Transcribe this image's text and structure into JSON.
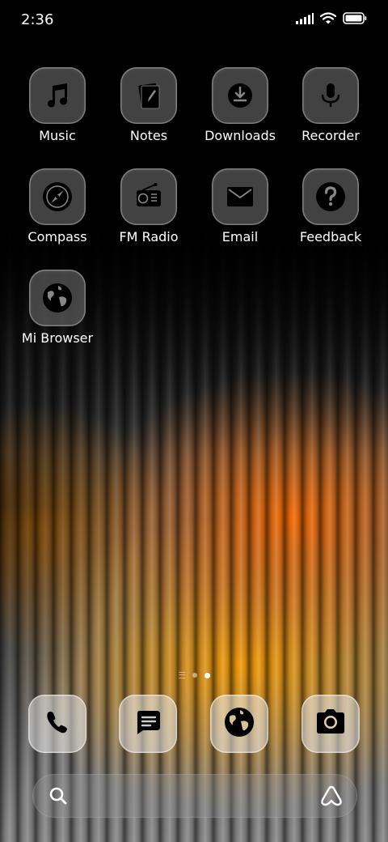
{
  "status_bar": {
    "time": "2:36",
    "icons": [
      "signal-icon",
      "wifi-icon",
      "battery-icon"
    ]
  },
  "apps": [
    {
      "label": "Music",
      "icon": "music-note-icon"
    },
    {
      "label": "Notes",
      "icon": "notes-icon"
    },
    {
      "label": "Downloads",
      "icon": "download-icon"
    },
    {
      "label": "Recorder",
      "icon": "microphone-icon"
    },
    {
      "label": "Compass",
      "icon": "compass-icon"
    },
    {
      "label": "FM Radio",
      "icon": "radio-icon"
    },
    {
      "label": "Email",
      "icon": "envelope-icon"
    },
    {
      "label": "Feedback",
      "icon": "question-icon"
    },
    {
      "label": "Mi Browser",
      "icon": "globe-icon"
    }
  ],
  "page_indicator": {
    "pages": 3,
    "current": 3
  },
  "dock": [
    {
      "icon": "phone-icon"
    },
    {
      "icon": "messages-icon"
    },
    {
      "icon": "browser-globe-icon"
    },
    {
      "icon": "camera-icon"
    }
  ],
  "search_bar": {
    "left_icon": "search-icon",
    "right_icon": "assistant-icon"
  },
  "colors": {
    "accent_orange": "#ff7a00",
    "accent_amber": "#ffa200",
    "icon_fill": "#000000",
    "label_text": "#ffffff"
  }
}
